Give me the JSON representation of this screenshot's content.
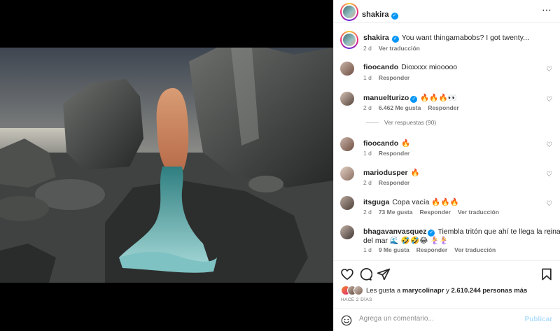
{
  "post": {
    "username": "shakira",
    "more_icon": "⋯",
    "verified_icon": "✓"
  },
  "caption": {
    "username": "shakira",
    "text": "You want thingamabobs? I got twenty...",
    "time": "2 d",
    "translate": "Ver traducción"
  },
  "comments": [
    {
      "username": "fioocando",
      "verified": false,
      "text": "Dioxxxx miooooo",
      "time": "1 d",
      "likes": "",
      "reply": "Responder",
      "translate": ""
    },
    {
      "username": "manuelturizo",
      "verified": true,
      "text": "🔥🔥🔥👀",
      "time": "2 d",
      "likes": "6.462 Me gusta",
      "reply": "Responder",
      "translate": ""
    },
    {
      "username": "fioocando",
      "verified": false,
      "text": "🔥",
      "time": "1 d",
      "likes": "",
      "reply": "Responder",
      "translate": ""
    },
    {
      "username": "mariodusper",
      "verified": false,
      "text": "🔥",
      "time": "2 d",
      "likes": "",
      "reply": "Responder",
      "translate": ""
    },
    {
      "username": "itsguga",
      "verified": false,
      "text": "Copa vacía 🔥🔥🔥",
      "time": "2 d",
      "likes": "73 Me gusta",
      "reply": "Responder",
      "translate": "Ver traducción"
    },
    {
      "username": "bhagavanvasquez",
      "verified": true,
      "text": "Tiembla tritón que ahí te llega la reina 🧜",
      "text2": "del mar 🌊 🤣🤣😂 🧜‍♀️🧜‍♀️",
      "time": "1 d",
      "likes": "9 Me gusta",
      "reply": "Responder",
      "translate": "Ver traducción"
    }
  ],
  "replies_link": "Ver respuestas (90)",
  "likes": {
    "prefix": "Les gusta a",
    "user": "marycolinapr",
    "joiner": "y",
    "count": "2.610.244 personas más"
  },
  "ago": "HACE 2 DÍAS",
  "add_comment": {
    "placeholder": "Agrega un comentario...",
    "publish": "Publicar"
  },
  "icons": {
    "like": "heart-icon",
    "comment": "comment-icon",
    "share": "share-icon",
    "save": "bookmark-icon",
    "emoji": "emoji-icon"
  },
  "colors": {
    "verified": "#0095f6",
    "publish_disabled": "#b2dffc",
    "secondary_text": "#737373"
  }
}
